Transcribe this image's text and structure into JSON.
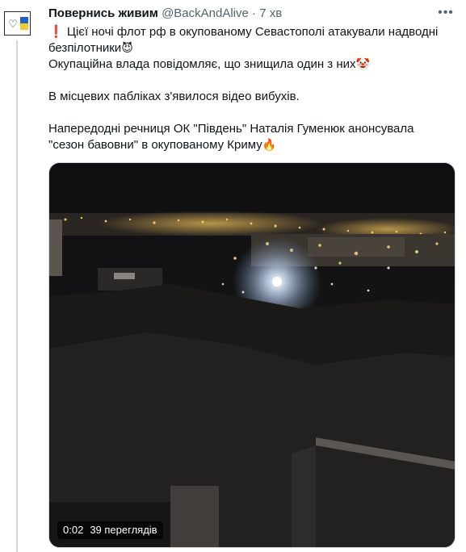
{
  "author": {
    "display_name": "Повернись живим",
    "handle": "@BackAndAlive",
    "separator": "·",
    "time": "7 хв",
    "avatar_icon": "heart-with-ukrainian-flag-icon"
  },
  "more_icon": "more-horizontal-icon",
  "tweet": {
    "line1_icon": "exclamation-icon",
    "line1": "Цієї ночі флот рф в окупованому Севастополі атакували надводні безпілотники",
    "line1_emoji": "😈",
    "line2": "Окупаційна влада повідомляє, що знищила один з них",
    "line2_emoji": "🤡",
    "line3": "В місцевих пабліках з'явилося відео вибухів.",
    "line4": "Напередодні речниця ОК \"Південь\" Наталія Гуменюк анонсувала \"сезон бавовни\" в окупованому Криму",
    "line4_emoji": "🔥"
  },
  "video": {
    "duration": "0:02",
    "views": "39 переглядів"
  },
  "colors": {
    "text": "#0f1419",
    "secondary": "#536471",
    "border": "#cfd9de",
    "flag_blue": "#1f63c6",
    "flag_yellow": "#f2cb2e"
  }
}
